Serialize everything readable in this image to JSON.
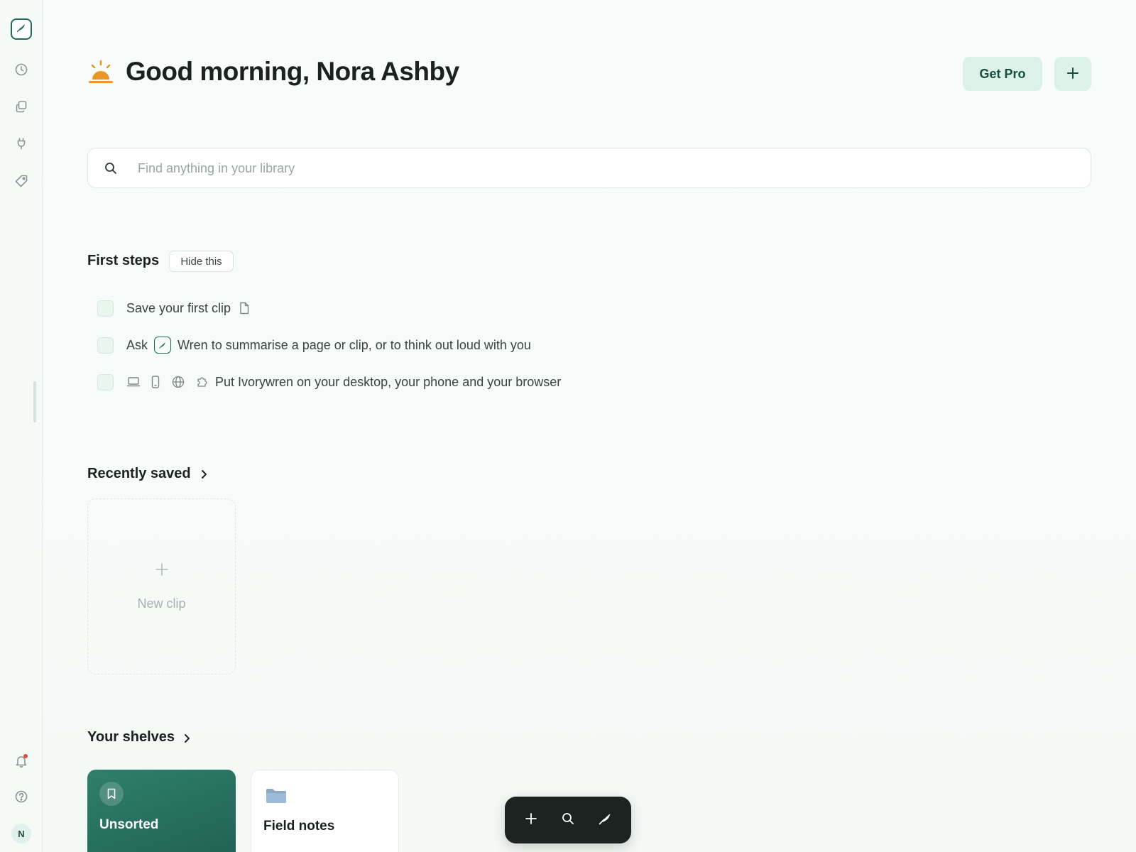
{
  "sidebar": {
    "logo_icon": "feather-logo-icon",
    "nav": [
      {
        "name": "recent",
        "icon": "clock-icon"
      },
      {
        "name": "library",
        "icon": "copy-icon"
      },
      {
        "name": "integrations",
        "icon": "plug-icon"
      },
      {
        "name": "tags",
        "icon": "tag-icon"
      }
    ],
    "bottom": [
      {
        "name": "notifications",
        "icon": "bell-icon",
        "has_badge": true
      },
      {
        "name": "help",
        "icon": "help-circle-icon"
      }
    ],
    "avatar_initial": "N"
  },
  "header": {
    "greeting": "Good morning, Nora Ashby",
    "greeting_icon": "sunrise-icon",
    "get_pro_label": "Get Pro",
    "add_icon": "plus-icon"
  },
  "search": {
    "placeholder": "Find anything in your library",
    "value": ""
  },
  "first_steps": {
    "title": "First steps",
    "hide_label": "Hide this",
    "steps": [
      {
        "text": "Save your first clip",
        "checked": false
      },
      {
        "prefix": "Ask",
        "text": "Wren to summarise a page or clip, or to think out loud with you",
        "checked": false
      },
      {
        "text": "Put Ivorywren on your desktop, your phone and your browser",
        "checked": false,
        "icons": [
          "laptop-icon",
          "phone-icon",
          "globe-icon",
          "puzzle-icon"
        ]
      }
    ]
  },
  "recently_saved": {
    "title": "Recently saved",
    "new_clip_label": "New clip"
  },
  "shelves": {
    "title": "Your shelves",
    "items": [
      {
        "label": "Unsorted",
        "icon": "bookmark-icon"
      },
      {
        "label": "Field notes",
        "icon": "folder-icon"
      }
    ]
  },
  "dock": {
    "buttons": [
      "plus-icon",
      "search-icon",
      "feather-icon"
    ]
  },
  "colors": {
    "accent": "#1d6b5c",
    "accent_light": "#dcf1e8",
    "sun": "#e8962a",
    "shelf_active": "#2a7362",
    "dock_bg": "#1d2321"
  }
}
